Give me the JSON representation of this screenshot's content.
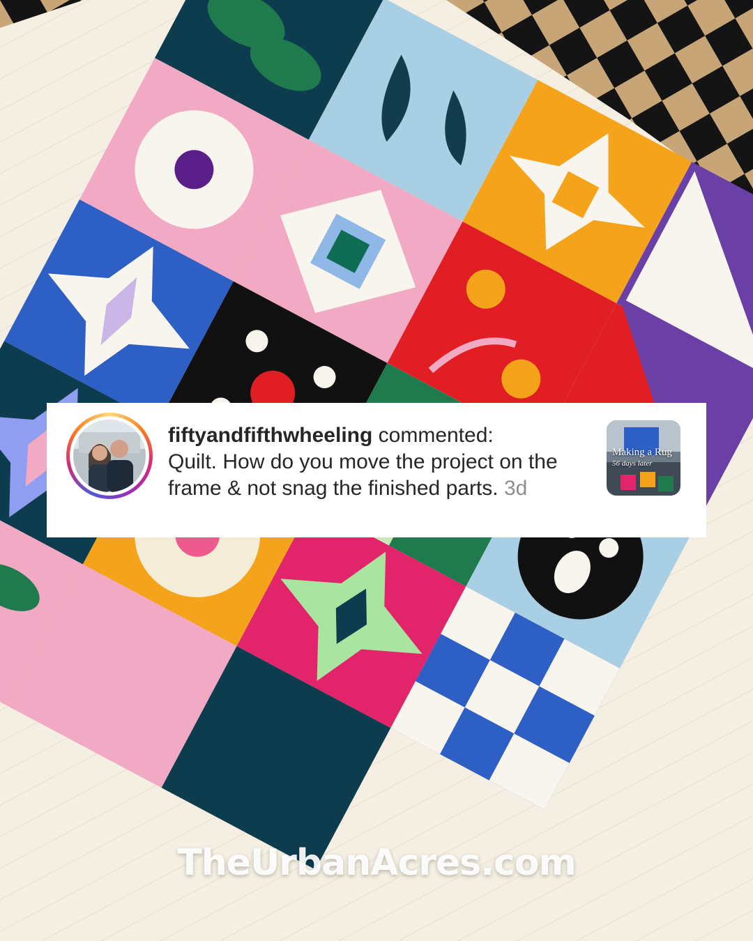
{
  "photo": {
    "subject": "punch-needle quilt-pattern rug in progress on cloth backing",
    "colors": {
      "backing": "#f4efe2",
      "navy": "#0d3c4f",
      "green": "#1f7a4d",
      "light_blue": "#a9cfe4",
      "pink": "#f2a9c4",
      "orange": "#f5a31a",
      "purple": "#6a3fa6",
      "red": "#e01e24",
      "royal_blue": "#2d5fc4",
      "hot_pink": "#e2246a",
      "black": "#111111",
      "white": "#f8f5ee",
      "mint": "#a9e4a0"
    }
  },
  "comment": {
    "username": "fiftyandfifthwheeling",
    "action": " commented:",
    "body": "Quilt. How do you move the project on the frame & not snag the finished parts.",
    "time": "3d"
  },
  "thumbnail": {
    "title": "Making a Rug",
    "subtitle": "56 days later"
  },
  "watermark": "TheUrbanAcres.com"
}
